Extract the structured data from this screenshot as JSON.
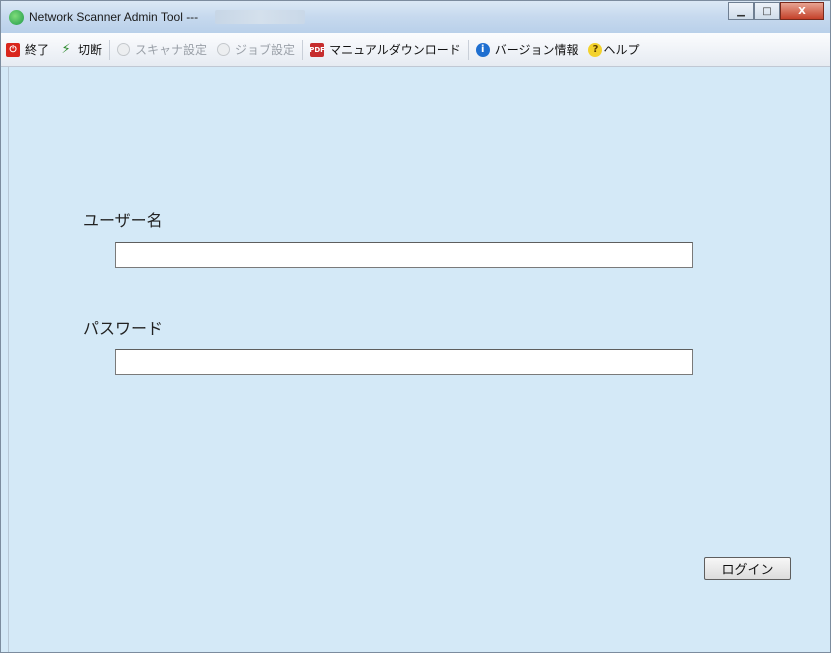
{
  "window": {
    "title": "Network Scanner Admin Tool  ---",
    "controls": {
      "minimize": "▁",
      "maximize": "□",
      "close": "X"
    }
  },
  "toolbar": {
    "items": [
      {
        "label": "終了",
        "icon": "exit-icon",
        "enabled": true
      },
      {
        "label": "切断",
        "icon": "disconnect-icon",
        "enabled": true
      },
      {
        "label": "スキャナ設定",
        "icon": "scanner-settings-icon",
        "enabled": false
      },
      {
        "label": "ジョブ設定",
        "icon": "job-settings-icon",
        "enabled": false
      },
      {
        "label": "マニュアルダウンロード",
        "icon": "pdf-manual-icon",
        "enabled": true
      },
      {
        "label": "バージョン情報",
        "icon": "info-icon",
        "enabled": true
      },
      {
        "label": "ヘルプ",
        "icon": "help-icon",
        "enabled": true
      }
    ]
  },
  "form": {
    "username_label": "ユーザー名",
    "username_value": "",
    "password_label": "パスワード",
    "password_value": "",
    "login_button": "ログイン"
  },
  "colors": {
    "background": "#d4e9f7",
    "exit_icon": "#d9261c",
    "info_icon": "#1f6fd0",
    "help_icon": "#f3d22d"
  }
}
